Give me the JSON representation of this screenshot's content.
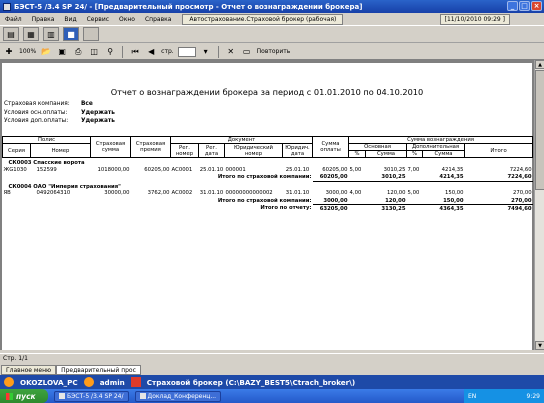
{
  "window": {
    "title": "БЭСТ-5 /3.4 SP 24/ - [Предварительный просмотр - Отчет о вознаграждении брокера]"
  },
  "menu": {
    "items": [
      "Файл",
      "Правка",
      "Вид",
      "Сервис",
      "Окно",
      "Справка"
    ],
    "active_tab": "Автострахование.Страховой брокер (рабочая)",
    "datetime": "[11/10/2010 09:29 ]"
  },
  "toolbar2": {
    "zoom": "100%",
    "page_label": "стр.",
    "repeat": "Повторить"
  },
  "report": {
    "title": "Отчет о вознаграждении брокера за период с 01.01.2010 по 04.10.2010",
    "params": [
      {
        "label": "Страховая компания:",
        "value": "Все"
      },
      {
        "label": "Условия осн.оплаты:",
        "value": "Удержать"
      },
      {
        "label": "Условия доп.оплаты:",
        "value": "Удержать"
      }
    ],
    "headers": {
      "polis": "Полис",
      "seria": "Серия",
      "nomer": "Номер",
      "str_summa": "Страховая сумма",
      "str_premia": "Страховая премия",
      "document": "Документ",
      "reg_nomer": "Рег. номер",
      "reg_data": "Рег. дата",
      "yur_nomer": "Юридический номер",
      "yur_data": "Юридич. дата",
      "summa_oplaty": "Сумма оплаты",
      "sum_voznagr": "Сумма вознаграждения",
      "osnovnaya": "Основная",
      "dopolnitelnaya": "Дополнительная",
      "pct": "%",
      "summa": "Сумма",
      "itogo": "Итого"
    },
    "groups": [
      {
        "name": "СК0003 Спасские ворота",
        "rows": [
          {
            "seria": "ЖG1030",
            "nomer": "152599",
            "ss": "1018000,00",
            "sp": "60205,00",
            "reg": "АС0001",
            "regd": "25.01.10",
            "yur": "000001",
            "yurd": "25.01.10",
            "opl": "60205,00",
            "p1": "5,00",
            "s1": "3010,25",
            "p2": "7,00",
            "s2": "4214,35",
            "it": "7224,60"
          }
        ],
        "total": {
          "label": "Итого по страховой компании:",
          "opl": "60205,00",
          "s1": "3010,25",
          "s2": "4214,35",
          "it": "7224,60"
        }
      },
      {
        "name": "СК0004 ОАО \"Империя страхования\"",
        "rows": [
          {
            "seria": "ЯВ",
            "nomer": "0492064310",
            "ss": "30000,00",
            "sp": "3762,00",
            "reg": "АС0002",
            "regd": "31.01.10",
            "yur": "00000000000002",
            "yurd": "31.01.10",
            "opl": "3000,00",
            "p1": "4,00",
            "s1": "120,00",
            "p2": "5,00",
            "s2": "150,00",
            "it": "270,00"
          }
        ],
        "total": {
          "label": "Итого по страховой компании:",
          "opl": "3000,00",
          "s1": "120,00",
          "s2": "150,00",
          "it": "270,00"
        }
      }
    ],
    "grand_total": {
      "label": "Итого по отчету:",
      "opl": "63205,00",
      "s1": "3130,25",
      "s2": "4364,35",
      "it": "7494,60"
    }
  },
  "status": {
    "page": "Стр. 1/1"
  },
  "tabs": [
    "Главное меню",
    "Предварительный прос"
  ],
  "infobar": {
    "user_pc": "OKOZLOVA_PC",
    "user": "admin",
    "module": "Страховой брокер (C:\\BAZY_BEST5\\Ctrach_broker\\)"
  },
  "taskbar": {
    "start": "пуск",
    "tasks": [
      "БЭСТ-5 /3.4 SP 24/",
      "Доклад_Конференц..."
    ],
    "lang": "EN",
    "time": "9:29"
  }
}
